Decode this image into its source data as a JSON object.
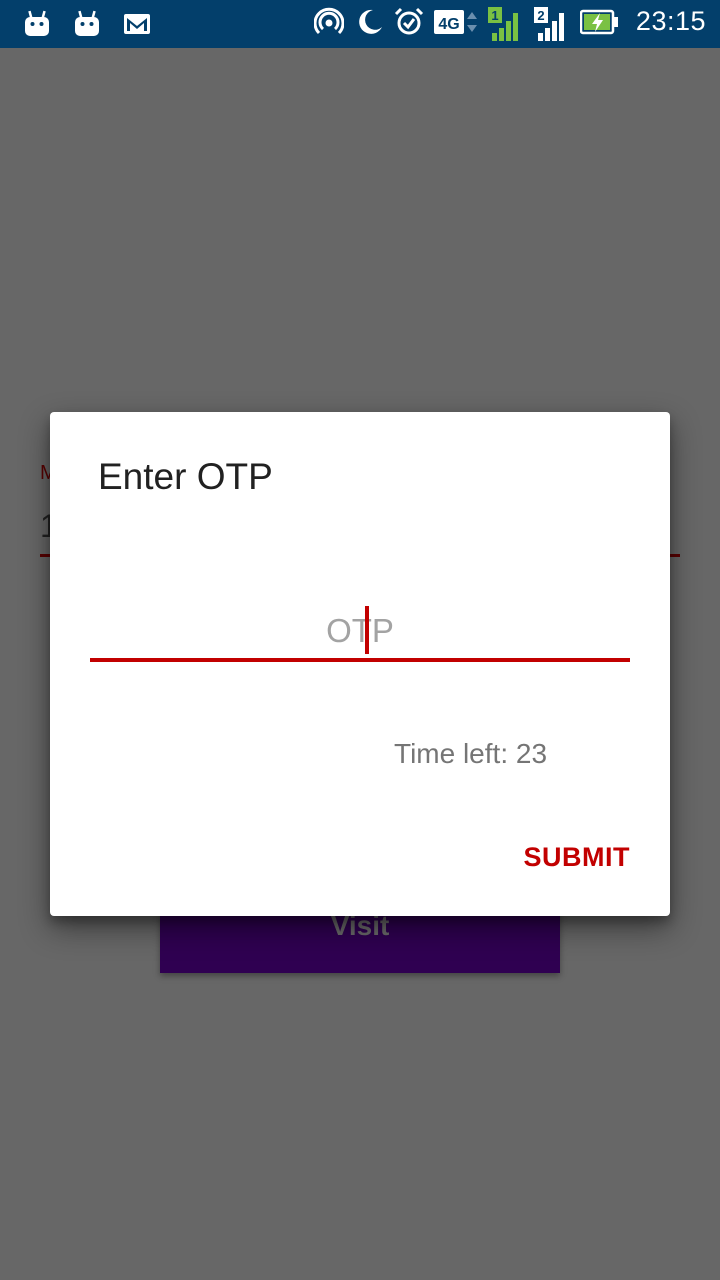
{
  "status_bar": {
    "time": "23:15",
    "left_icons": [
      "android-icon",
      "android-icon",
      "gmail-icon"
    ],
    "right_icons": [
      "hotspot-icon",
      "moon-icon",
      "alarm-icon",
      "4g-icon",
      "signal-sim1-icon",
      "signal-sim2-icon",
      "battery-charging-icon"
    ],
    "network_label": "4G",
    "sim1_label": "1",
    "sim2_label": "2"
  },
  "background": {
    "field_label": "M",
    "field_value": "1",
    "visit_button": "Visit"
  },
  "dialog": {
    "title": "Enter OTP",
    "otp_placeholder": "OTP",
    "otp_value": "",
    "timer_text": "Time left: 23",
    "submit_label": "SUBMIT"
  },
  "colors": {
    "status_bar": "#033f6b",
    "scrim": "#676767",
    "accent": "#c20000",
    "button_bg": "#2f0051"
  }
}
